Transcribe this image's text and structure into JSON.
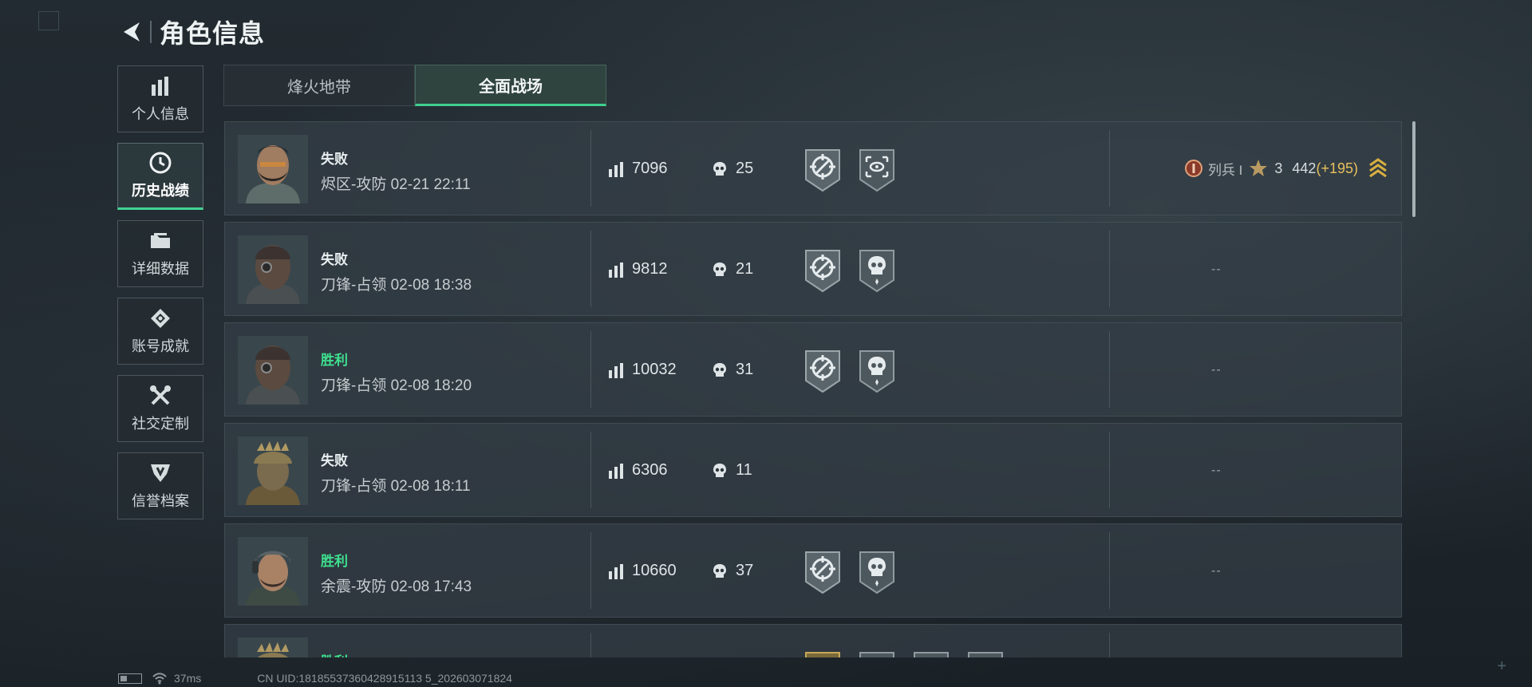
{
  "header": {
    "title": "角色信息"
  },
  "sidebar": {
    "items": [
      {
        "label": "个人信息",
        "icon": "bar-chart-icon",
        "active": false
      },
      {
        "label": "历史战绩",
        "icon": "clock-icon",
        "active": true
      },
      {
        "label": "详细数据",
        "icon": "folder-icon",
        "active": false
      },
      {
        "label": "账号成就",
        "icon": "achievement-icon",
        "active": false
      },
      {
        "label": "社交定制",
        "icon": "tools-icon",
        "active": false
      },
      {
        "label": "信誉档案",
        "icon": "reputation-icon",
        "active": false
      }
    ]
  },
  "tabs": [
    {
      "label": "烽火地带",
      "active": false
    },
    {
      "label": "全面战场",
      "active": true
    }
  ],
  "matches": [
    {
      "result": "失败",
      "win": false,
      "map": "烬区-攻防",
      "time": "02-21 22:11",
      "score": "7096",
      "kills": "25",
      "badges": [
        "crosshair-badge-icon",
        "scope-badge-icon"
      ],
      "rank": {
        "name": "列兵 I",
        "stars": "3",
        "points": "442",
        "delta": "(+195)"
      }
    },
    {
      "result": "失败",
      "win": false,
      "map": "刀锋-占领",
      "time": "02-08 18:38",
      "score": "9812",
      "kills": "21",
      "badges": [
        "crosshair-badge-icon",
        "skull-badge-icon"
      ],
      "rank_empty": "--"
    },
    {
      "result": "胜利",
      "win": true,
      "map": "刀锋-占领",
      "time": "02-08 18:20",
      "score": "10032",
      "kills": "31",
      "badges": [
        "crosshair-badge-icon",
        "skull-badge-icon"
      ],
      "rank_empty": "--"
    },
    {
      "result": "失败",
      "win": false,
      "map": "刀锋-占领",
      "time": "02-08 18:11",
      "score": "6306",
      "kills": "11",
      "badges": [],
      "rank_empty": "--"
    },
    {
      "result": "胜利",
      "win": true,
      "map": "余震-攻防",
      "time": "02-08 17:43",
      "score": "10660",
      "kills": "37",
      "badges": [
        "crosshair-badge-icon",
        "skull-badge-icon"
      ],
      "rank_empty": "--"
    },
    {
      "result": "胜利",
      "win": true,
      "partial": true
    }
  ],
  "status": {
    "ping": "37ms",
    "uid": "CN UID:18185537360428915113 5_202603071824"
  },
  "colors": {
    "win": "#3ee08f",
    "accent": "#41d392",
    "delta": "#e8c15c"
  }
}
